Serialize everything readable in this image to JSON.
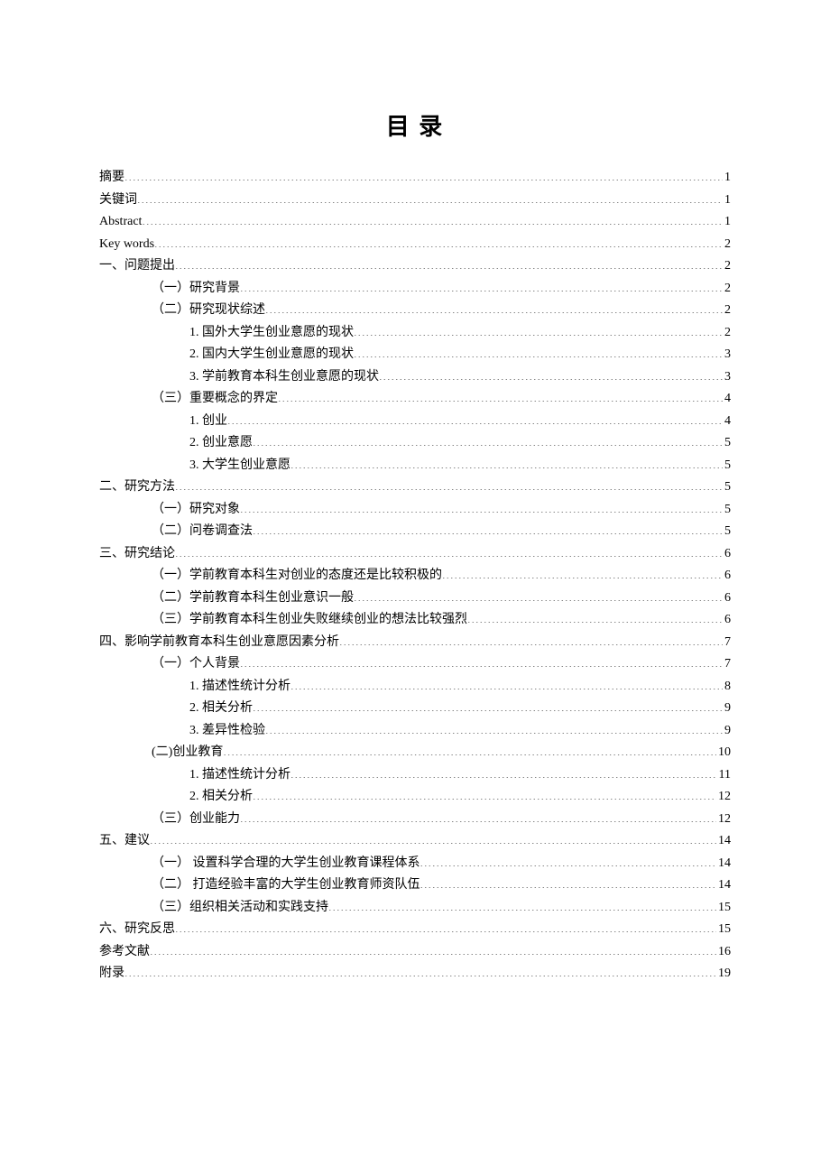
{
  "title": "目 录",
  "entries": [
    {
      "label": "摘要",
      "page": "1",
      "indent": 0
    },
    {
      "label": "关键词",
      "page": "1",
      "indent": 0
    },
    {
      "label": "Abstract",
      "page": "1",
      "indent": 0
    },
    {
      "label": "Key words",
      "page": "2",
      "indent": 0
    },
    {
      "label": "一、问题提出",
      "page": "2",
      "indent": 0
    },
    {
      "label": "（一）研究背景",
      "page": "2",
      "indent": 1
    },
    {
      "label": "（二）研究现状综述",
      "page": "2",
      "indent": 1
    },
    {
      "label": "1. 国外大学生创业意愿的现状",
      "page": "2",
      "indent": 2
    },
    {
      "label": "2. 国内大学生创业意愿的现状",
      "page": "3",
      "indent": 2
    },
    {
      "label": "3. 学前教育本科生创业意愿的现状",
      "page": "3",
      "indent": 2
    },
    {
      "label": "（三）重要概念的界定",
      "page": "4",
      "indent": 1
    },
    {
      "label": "1. 创业",
      "page": "4",
      "indent": 2
    },
    {
      "label": "2. 创业意愿",
      "page": "5",
      "indent": 2
    },
    {
      "label": "3. 大学生创业意愿",
      "page": "5",
      "indent": 2
    },
    {
      "label": "二、研究方法",
      "page": "5",
      "indent": 0
    },
    {
      "label": "（一）研究对象",
      "page": "5",
      "indent": 1
    },
    {
      "label": "（二）问卷调查法",
      "page": "5",
      "indent": 1
    },
    {
      "label": "三、研究结论",
      "page": "6",
      "indent": 0
    },
    {
      "label": "（一）学前教育本科生对创业的态度还是比较积极的",
      "page": "6",
      "indent": 1
    },
    {
      "label": "（二）学前教育本科生创业意识一般",
      "page": "6",
      "indent": 1
    },
    {
      "label": "（三）学前教育本科生创业失败继续创业的想法比较强烈",
      "page": "6",
      "indent": 1
    },
    {
      "label": "四、影响学前教育本科生创业意愿因素分析",
      "page": "7",
      "indent": 0
    },
    {
      "label": "（一）个人背景",
      "page": "7",
      "indent": 1
    },
    {
      "label": "1. 描述性统计分析",
      "page": "8",
      "indent": 2
    },
    {
      "label": "2. 相关分析",
      "page": "9",
      "indent": 2
    },
    {
      "label": "3. 差异性检验",
      "page": "9",
      "indent": 2
    },
    {
      "label": "(二)创业教育",
      "page": "10",
      "indent": 1
    },
    {
      "label": "1. 描述性统计分析",
      "page": "11",
      "indent": 2
    },
    {
      "label": "2.  相关分析",
      "page": "12",
      "indent": 2
    },
    {
      "label": "（三）创业能力",
      "page": "12",
      "indent": 1
    },
    {
      "label": "五、建议",
      "page": "14",
      "indent": 0
    },
    {
      "label": "（一） 设置科学合理的大学生创业教育课程体系",
      "page": "14",
      "indent": 1
    },
    {
      "label": "（二） 打造经验丰富的大学生创业教育师资队伍",
      "page": "14",
      "indent": 1
    },
    {
      "label": "（三）组织相关活动和实践支持",
      "page": "15",
      "indent": 1
    },
    {
      "label": "六、研究反思",
      "page": "15",
      "indent": 0
    },
    {
      "label": "参考文献",
      "page": "16",
      "indent": 0
    },
    {
      "label": "附录",
      "page": "19",
      "indent": 0
    }
  ]
}
